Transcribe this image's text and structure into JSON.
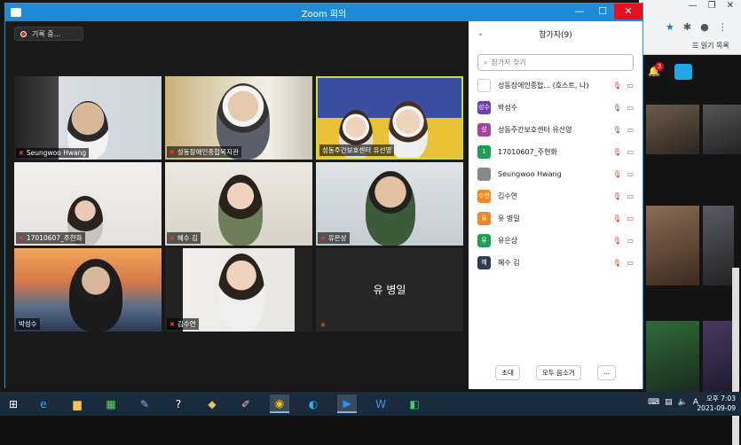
{
  "window": {
    "title": "Zoom 회의"
  },
  "recording": {
    "label": "기록 중..."
  },
  "tiles": [
    {
      "name": "Seungwoo Hwang",
      "muted": true
    },
    {
      "name": "성동장애인종합복지관",
      "muted": true
    },
    {
      "name": "성동주간보호센터 유선영",
      "muted": true
    },
    {
      "name": "17010607_주현화",
      "muted": true
    },
    {
      "name": "혜수 김",
      "muted": true
    },
    {
      "name": "유은상",
      "muted": true
    },
    {
      "name": "박성수",
      "muted": false
    },
    {
      "name": "김수연",
      "muted": true
    },
    {
      "name": "유 병일",
      "muted": true
    }
  ],
  "panel": {
    "title": "참가자(9)",
    "search_placeholder": "참가자 찾기",
    "participants": [
      {
        "avatar": "",
        "name": "성동장애인종합...  (호스트, 나)",
        "color": "#ffffff"
      },
      {
        "avatar": "성수",
        "name": "박성수",
        "color": "#6b3fb5"
      },
      {
        "avatar": "성",
        "name": "성동주간보호센터 유선영",
        "color": "#a7419a"
      },
      {
        "avatar": "1",
        "name": "17010607_주현화",
        "color": "#1f9d55"
      },
      {
        "avatar": "",
        "name": "Seungwoo Hwang",
        "color": "#888888"
      },
      {
        "avatar": "수연",
        "name": "김수연",
        "color": "#f08a24"
      },
      {
        "avatar": "유",
        "name": "유 병일",
        "color": "#f08a24"
      },
      {
        "avatar": "유",
        "name": "유은상",
        "color": "#1f9d55"
      },
      {
        "avatar": "혜",
        "name": "혜수 김",
        "color": "#2c3e50"
      }
    ],
    "invite_label": "초대",
    "mute_all_label": "모두 음소거",
    "more_label": "..."
  },
  "browser": {
    "bookmark_label": "읽기 목록",
    "notif_count": "3"
  },
  "taskbar": {
    "time": "오후 7:03",
    "date": "2021-09-09",
    "ime": "A"
  }
}
